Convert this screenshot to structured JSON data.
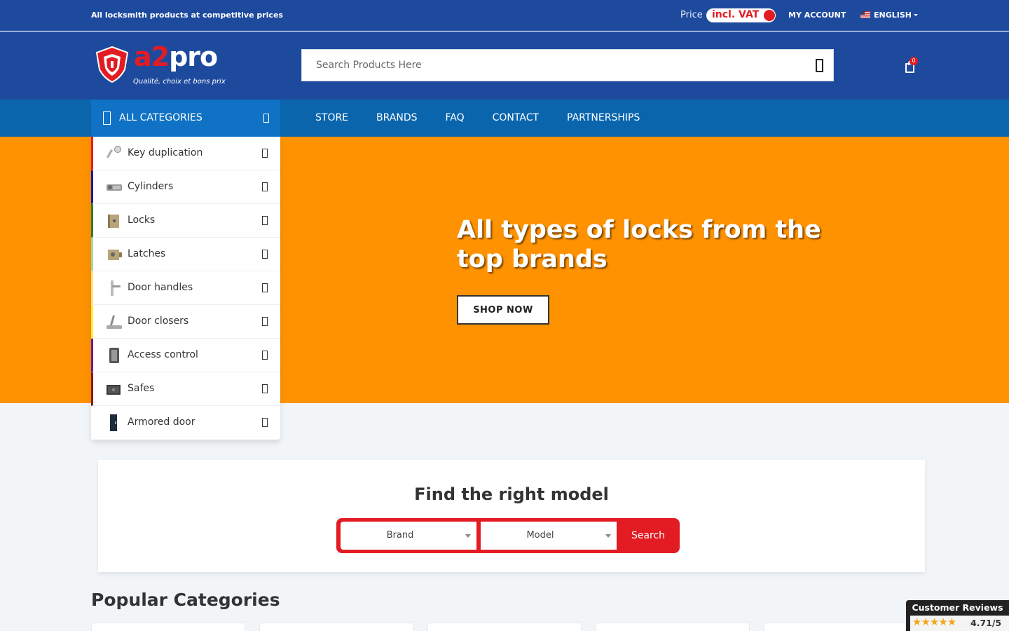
{
  "topbar": {
    "tagline": "All locksmith products at competitive prices",
    "price_label": "Price",
    "vat_label": "incl. VAT",
    "account": "MY ACCOUNT",
    "language": "ENGLISH"
  },
  "header": {
    "logo_a2": "a2",
    "logo_pro": "pro",
    "logo_tagline": "Qualité, choix et bons prix",
    "search_placeholder": "Search Products Here",
    "cart_count": "0"
  },
  "nav": {
    "all_categories": "ALL CATEGORIES",
    "links": [
      "STORE",
      "BRANDS",
      "FAQ",
      "CONTACT",
      "PARTNERSHIPS"
    ]
  },
  "categories": [
    {
      "label": "Key duplication",
      "accent": "#e31b23"
    },
    {
      "label": "Cylinders",
      "accent": "#1a1aa6"
    },
    {
      "label": "Locks",
      "accent": "#2e7d32"
    },
    {
      "label": "Latches",
      "accent": "#a5d6a7"
    },
    {
      "label": "Door handles",
      "accent": "#ffe082"
    },
    {
      "label": "Door closers",
      "accent": "#ffeb3b"
    },
    {
      "label": "Access control",
      "accent": "#6a1b9a"
    },
    {
      "label": "Safes",
      "accent": "#8b1a1a"
    },
    {
      "label": "Armored door",
      "accent": "#ffffff"
    }
  ],
  "hero": {
    "heading": "All types of locks from the top brands",
    "cta": "SHOP NOW",
    "background": "#ff9200"
  },
  "finder": {
    "title": "Find the right model",
    "brand_placeholder": "Brand",
    "model_placeholder": "Model",
    "search_label": "Search"
  },
  "popular": {
    "title": "Popular Categories"
  },
  "reviews": {
    "title": "Customer Reviews",
    "stars": "★★★★★",
    "score": "4.71/5"
  },
  "colors": {
    "primary_blue": "#1e4a9e",
    "nav_blue": "#0a65ad",
    "accent_red": "#e31b23",
    "hero_orange": "#ff9200"
  }
}
